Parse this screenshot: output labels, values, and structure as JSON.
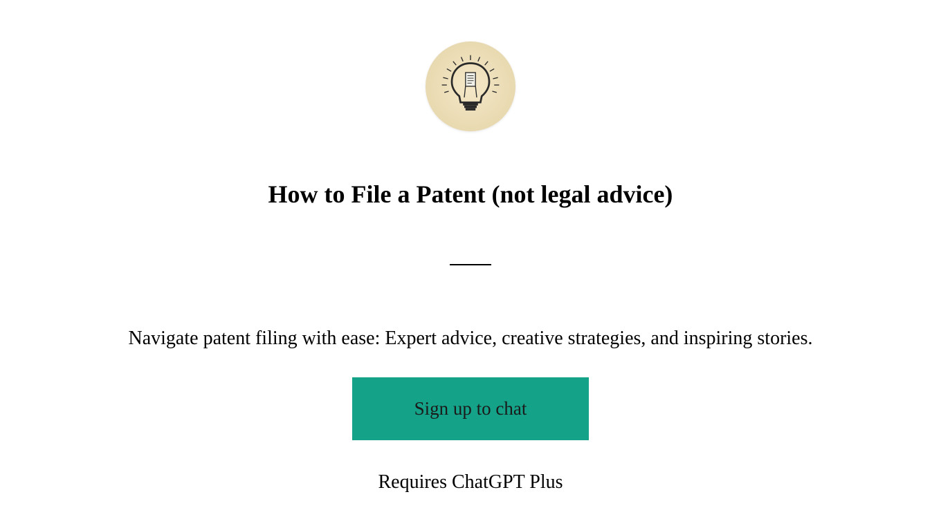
{
  "header": {
    "icon_name": "lightbulb-patent-icon",
    "title": "How to File a Patent (not legal advice)"
  },
  "main": {
    "description": "Navigate patent filing with ease: Expert advice, creative strategies, and inspiring stories.",
    "signup_button_label": "Sign up to chat",
    "requires_text": "Requires ChatGPT Plus"
  },
  "colors": {
    "button_bg": "#14a388",
    "logo_bg": "#f5e8c8"
  }
}
